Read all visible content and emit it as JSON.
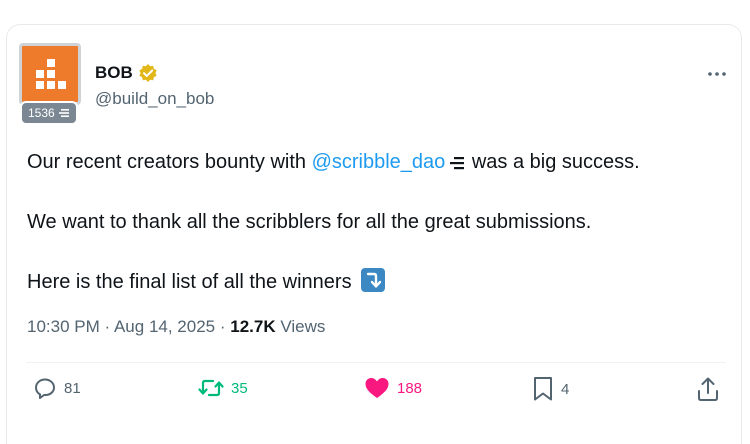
{
  "author": {
    "name": "BOB",
    "handle": "@build_on_bob",
    "badge_count": "1536",
    "verified_color": "#e2b719",
    "avatar_color": "#ee7a2c"
  },
  "tweet": {
    "line1_before": "Our recent creators bounty with ",
    "mention": "@scribble_dao",
    "line1_after": " was a big success.",
    "line2": "We want to thank all the scribblers for all the great submissions.",
    "line3": "Here is the final list of all the winners"
  },
  "meta": {
    "time": "10:30 PM",
    "date": "Aug 14, 2025",
    "views_count": "12.7K",
    "views_label": "Views"
  },
  "actions": {
    "replies": "81",
    "retweets": "35",
    "likes": "188",
    "bookmarks": "4"
  },
  "icons": [
    "verified-badge-icon",
    "more-icon",
    "reply-icon",
    "retweet-icon",
    "heart-icon",
    "bookmark-icon",
    "share-icon",
    "arrow-down-emoji-icon",
    "affiliate-list-icon"
  ]
}
